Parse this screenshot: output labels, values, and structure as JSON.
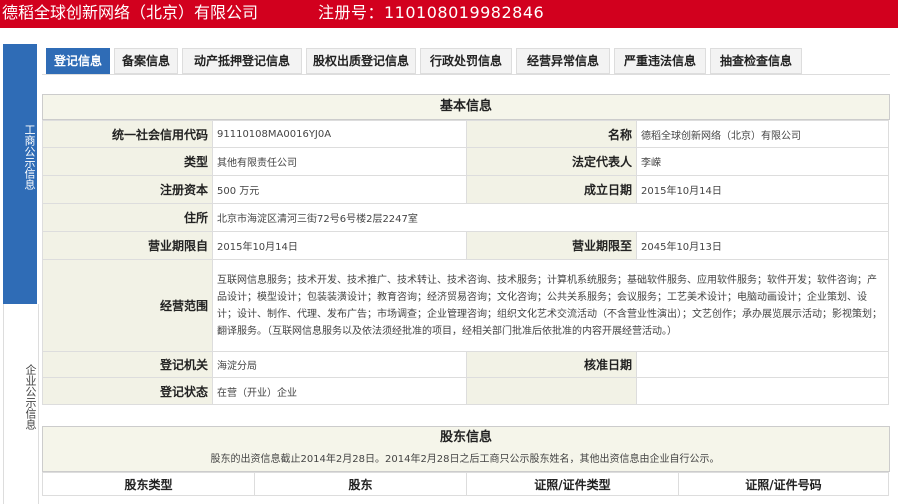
{
  "header": {
    "company": "德稻全球创新网络（北京）有限公司",
    "reg_no": "注册号：110108019982846"
  },
  "sidebar": {
    "section1": "工商公示信息",
    "section2": "企业公示信息"
  },
  "tabs": [
    "登记信息",
    "备案信息",
    "动产抵押登记信息",
    "股权出质登记信息",
    "行政处罚信息",
    "经营异常信息",
    "严重违法信息",
    "抽查检查信息"
  ],
  "basic": {
    "title": "基本信息",
    "credit_code_label": "统一社会信用代码",
    "credit_code": "91110108MA0016YJ0A",
    "name_label": "名称",
    "name": "德稻全球创新网络（北京）有限公司",
    "type_label": "类型",
    "type": "其他有限责任公司",
    "legal_rep_label": "法定代表人",
    "legal_rep": "李嵘",
    "capital_label": "注册资本",
    "capital": "500 万元",
    "founded_label": "成立日期",
    "founded": "2015年10月14日",
    "address_label": "住所",
    "address": "北京市海淀区清河三街72号6号楼2层2247室",
    "term_from_label": "营业期限自",
    "term_from": "2015年10月14日",
    "term_to_label": "营业期限至",
    "term_to": "2045年10月13日",
    "scope_label": "经营范围",
    "scope": "互联网信息服务；技术开发、技术推广、技术转让、技术咨询、技术服务；计算机系统服务；基础软件服务、应用软件服务；软件开发；软件咨询；产品设计；模型设计；包装装潢设计；教育咨询；经济贸易咨询；文化咨询；公共关系服务；会议服务；工艺美术设计；电脑动画设计；企业策划、设计；设计、制作、代理、发布广告；市场调查；企业管理咨询；组织文化艺术交流活动（不含营业性演出）；文艺创作；承办展览展示活动；影视策划；翻译服务。（互联网信息服务以及依法须经批准的项目，经相关部门批准后依批准的内容开展经营活动。）",
    "authority_label": "登记机关",
    "authority": "海淀分局",
    "approval_label": "核准日期",
    "approval": "",
    "status_label": "登记状态",
    "status": "在营（开业）企业"
  },
  "shareholders": {
    "title": "股东信息",
    "note": "股东的出资信息截止2014年2月28日。2014年2月28日之后工商只公示股东姓名，其他出资信息由企业自行公示。",
    "cols": [
      "股东类型",
      "股东",
      "证照/证件类型",
      "证照/证件号码"
    ]
  }
}
